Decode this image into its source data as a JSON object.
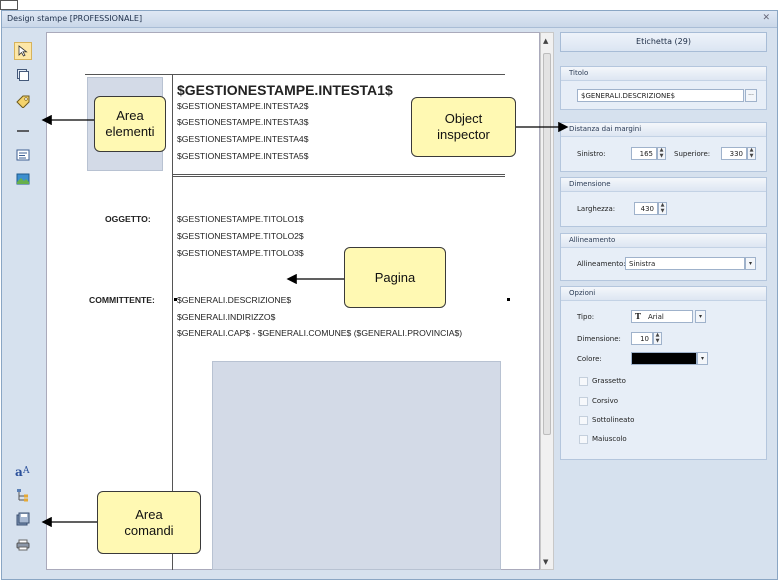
{
  "window": {
    "title": "Design stampe [PROFESSIONALE]",
    "close_glyph": "✕"
  },
  "toolbar": {
    "tools": [
      {
        "icon": "pointer-icon"
      },
      {
        "icon": "frame-icon"
      },
      {
        "icon": "text-label-icon"
      },
      {
        "icon": "line-icon"
      },
      {
        "icon": "field-icon"
      },
      {
        "icon": "image-icon"
      }
    ],
    "commands": [
      {
        "icon": "font-icon"
      },
      {
        "icon": "tree-icon"
      },
      {
        "icon": "save-icon"
      },
      {
        "icon": "print-icon"
      }
    ]
  },
  "page": {
    "header_main": "$GESTIONESTAMPE.INTESTA1$",
    "header_lines": [
      "$GESTIONESTAMPE.INTESTA2$",
      "$GESTIONESTAMPE.INTESTA3$",
      "$GESTIONESTAMPE.INTESTA4$",
      "$GESTIONESTAMPE.INTESTA5$"
    ],
    "oggetto_label": "OGGETTO:",
    "oggetto_lines": [
      "$GESTIONESTAMPE.TITOLO1$",
      "$GESTIONESTAMPE.TITOLO2$",
      "$GESTIONESTAMPE.TITOLO3$"
    ],
    "committente_label": "COMMITTENTE:",
    "committente_lines": [
      "$GENERALI.DESCRIZIONE$",
      "$GENERALI.INDIRIZZO$",
      "$GENERALI.CAP$ - $GENERALI.COMUNE$ ($GENERALI.PROVINCIA$)"
    ]
  },
  "inspector": {
    "heading": "Etichetta (29)",
    "titolo": {
      "group": "Titolo",
      "value": "$GENERALI.DESCRIZIONE$",
      "btn": "···"
    },
    "margini": {
      "group": "Distanza dai margini",
      "sinistro_label": "Sinistro:",
      "sinistro": "165",
      "superiore_label": "Superiore:",
      "superiore": "330"
    },
    "dimensione": {
      "group": "Dimensione",
      "larghezza_label": "Larghezza:",
      "larghezza": "430"
    },
    "allineamento": {
      "group": "Allineamento",
      "label": "Allineamento:",
      "value": "Sinistra"
    },
    "opzioni": {
      "group": "Opzioni",
      "tipo_label": "Tipo:",
      "tipo": "Arial",
      "tipo_glyph": "T",
      "dimensione_label": "Dimensione:",
      "dimensione": "10",
      "colore_label": "Colore:",
      "colore": "#000000",
      "checks": [
        "Grassetto",
        "Corsivo",
        "Sottolineato",
        "Maiuscolo"
      ]
    }
  },
  "callouts": {
    "area_elementi": "Area\nelementi",
    "object_inspector": "Object\ninspector",
    "pagina": "Pagina",
    "area_comandi": "Area\ncomandi"
  }
}
